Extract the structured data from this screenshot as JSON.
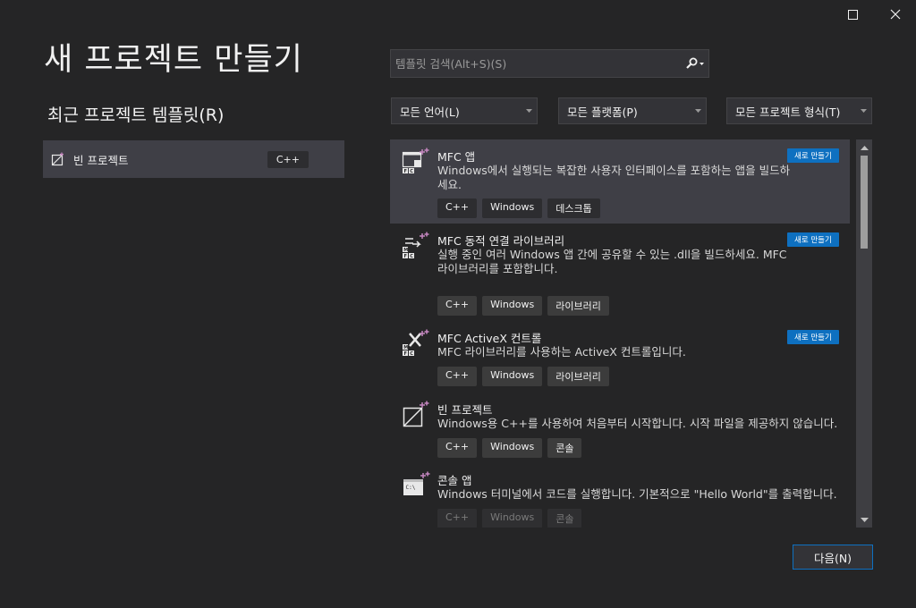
{
  "window": {
    "maximize_icon": "maximize-icon",
    "close_icon": "close-icon"
  },
  "page_title": "새 프로젝트 만들기",
  "recent": {
    "title": "최근 프로젝트 템플릿(R)",
    "items": [
      {
        "label": "빈 프로젝트",
        "tag": "C++",
        "icon": "empty-project-icon"
      }
    ]
  },
  "search": {
    "placeholder": "템플릿 검색(Alt+S)(S)",
    "value": "",
    "icon": "search-icon"
  },
  "filters": {
    "language": "모든 언어(L)",
    "platform": "모든 플랫폼(P)",
    "project_type": "모든 프로젝트 형식(T)"
  },
  "templates": [
    {
      "name": "MFC 앱",
      "description": "Windows에서 실행되는 복잡한 사용자 인터페이스를 포함하는 앱을 빌드하세요.",
      "badge": "새로 만들기",
      "tags": [
        "C++",
        "Windows",
        "데스크톱"
      ],
      "icon": "mfc-app-icon"
    },
    {
      "name": "MFC 동적 연결 라이브러리",
      "description": "실행 중인 여러 Windows 앱 간에 공유할 수 있는 .dll을 빌드하세요. MFC 라이브러리를 포함합니다.",
      "badge": "새로 만들기",
      "tags": [
        "C++",
        "Windows",
        "라이브러리"
      ],
      "icon": "mfc-dll-icon"
    },
    {
      "name": "MFC ActiveX 컨트롤",
      "description": "MFC 라이브러리를 사용하는 ActiveX 컨트롤입니다.",
      "badge": "새로 만들기",
      "tags": [
        "C++",
        "Windows",
        "라이브러리"
      ],
      "icon": "mfc-activex-icon"
    },
    {
      "name": "빈 프로젝트",
      "description": "Windows용 C++를 사용하여 처음부터 시작합니다. 시작 파일을 제공하지 않습니다.",
      "badge": "",
      "tags": [
        "C++",
        "Windows",
        "콘솔"
      ],
      "icon": "empty-project-icon"
    },
    {
      "name": "콘솔 앱",
      "description": "Windows 터미널에서 코드를 실행합니다. 기본적으로 \"Hello World\"를 출력합니다.",
      "badge": "",
      "tags": [
        "C++",
        "Windows",
        "콘솔"
      ],
      "icon": "console-app-icon",
      "console_prompt": "C:\\"
    }
  ],
  "next_button": "다음(N)",
  "colors": {
    "accent": "#0e70c0",
    "background": "#252526",
    "selected": "#3f3f46"
  }
}
